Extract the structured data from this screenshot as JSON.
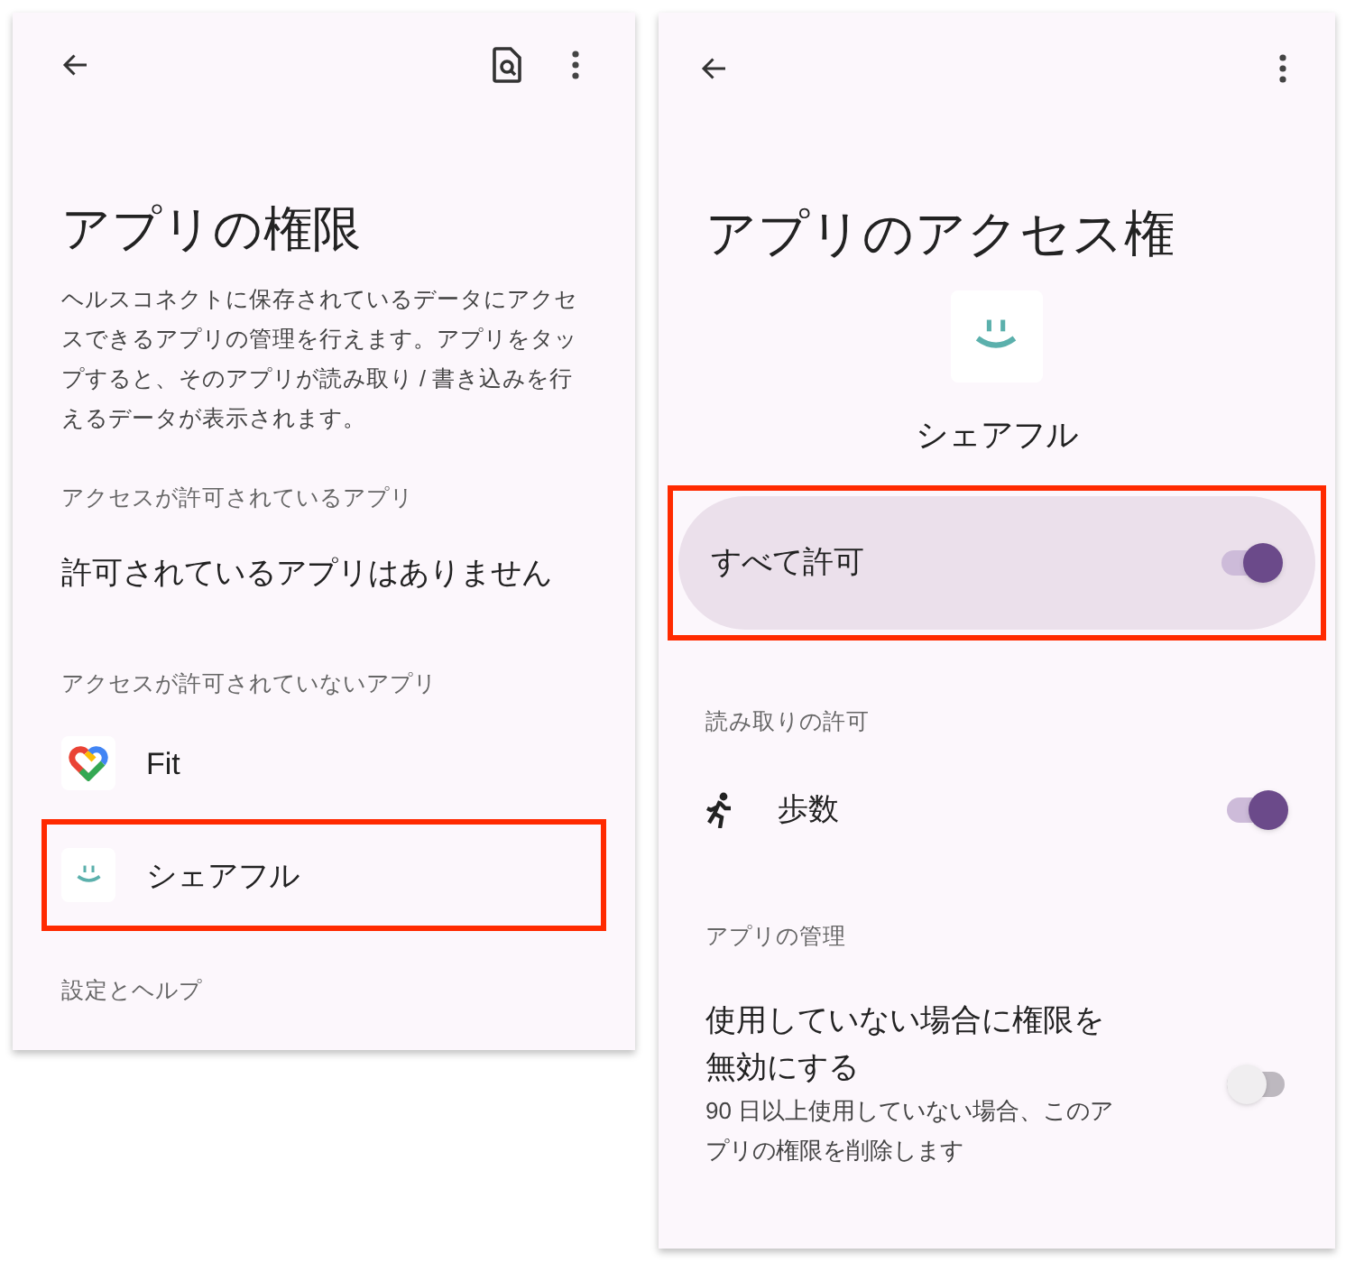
{
  "left_screen": {
    "title": "アプリの権限",
    "description": "ヘルスコネクトに保存されているデータにアクセスできるアプリの管理を行えます。アプリをタップすると、そのアプリが読み取り / 書き込みを行えるデータが表示されます。",
    "sections": [
      {
        "header": "アクセスが許可されているアプリ",
        "items": [
          {
            "kind": "empty",
            "label": "許可されているアプリはありません",
            "highlighted": false
          }
        ]
      },
      {
        "header": "アクセスが許可されていないアプリ",
        "items": [
          {
            "kind": "heart-app",
            "label": "Fit",
            "highlighted": false
          },
          {
            "kind": "smile-app",
            "label": "シェアフル",
            "highlighted": true
          }
        ]
      },
      {
        "header": "設定とヘルプ"
      }
    ]
  },
  "right_screen": {
    "title": "アプリのアクセス権",
    "app_name": "シェアフル",
    "master": {
      "label": "すべて許可",
      "on": true,
      "highlighted": true
    },
    "sections": [
      {
        "header": "読み取りの許可",
        "items": [
          {
            "kind": "permission",
            "label": "歩数",
            "on": true
          }
        ]
      },
      {
        "header": "アプリの管理",
        "items": [
          {
            "kind": "setting",
            "label": "使用していない場合に権限を無効にする",
            "description": "90 日以上使用していない場合、このアプリの権限を削除します",
            "on": false
          }
        ]
      }
    ]
  }
}
